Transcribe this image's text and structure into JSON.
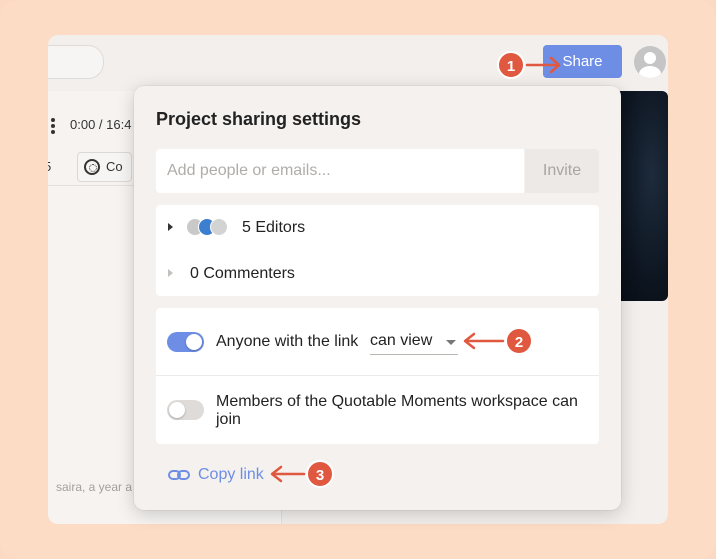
{
  "header": {
    "share_label": "Share"
  },
  "player": {
    "time": "0:00 / 16:4",
    "count_label": "5",
    "comments_label": "Co",
    "author_line": "saira, a year a"
  },
  "share_dialog": {
    "title": "Project sharing settings",
    "email_placeholder": "Add people or emails...",
    "invite_label": "Invite",
    "editors_label": "5 Editors",
    "commenters_label": "0 Commenters",
    "link_setting_label": "Anyone with the link",
    "link_permission": "can view",
    "workspace_label": "Members of the Quotable Moments workspace can join",
    "copy_link_label": "Copy link",
    "link_toggle_on": true,
    "workspace_toggle_on": false
  },
  "annotations": {
    "badges": [
      "1",
      "2",
      "3"
    ],
    "color": "#e0583f"
  },
  "colors": {
    "accent": "#6e8ee6",
    "background": "#fcdcc5"
  }
}
